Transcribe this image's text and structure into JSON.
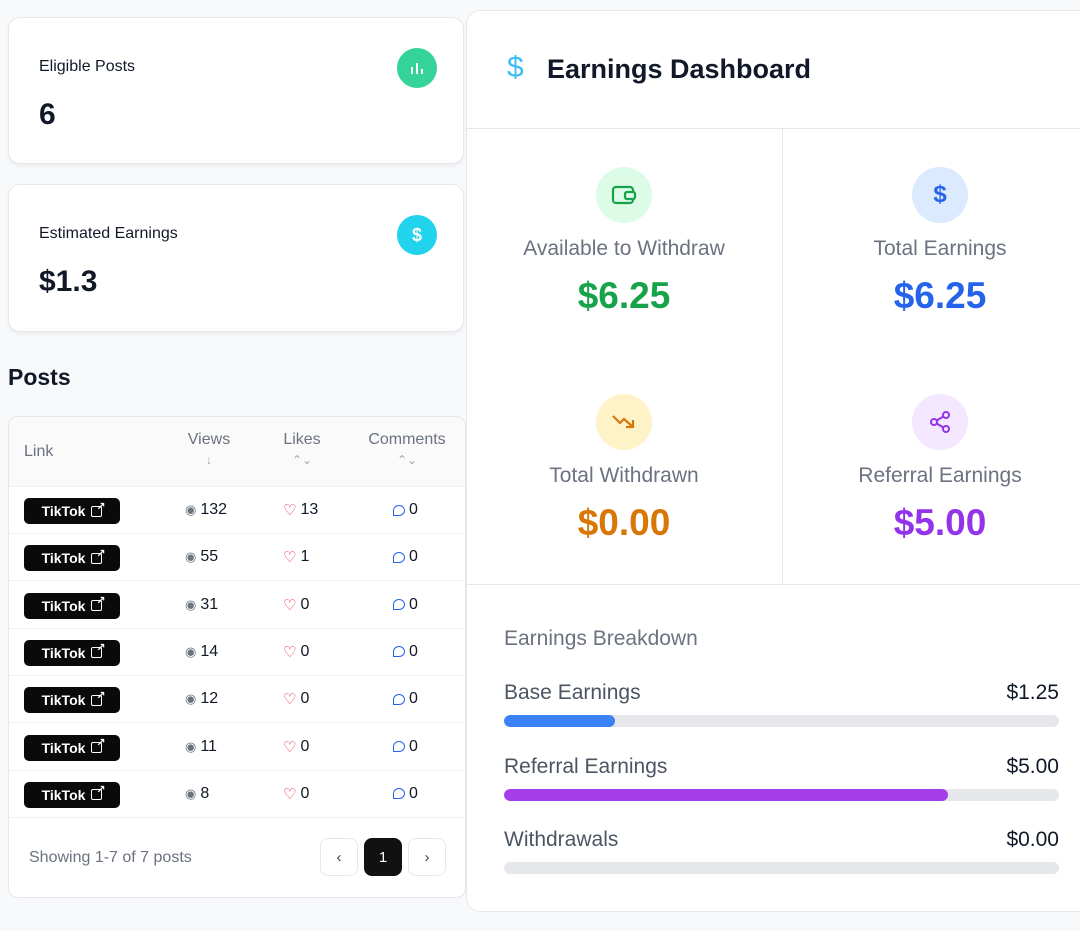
{
  "cards": {
    "eligible": {
      "label": "Eligible Posts",
      "value": "6",
      "icon": "bar-chart-icon",
      "color": "#34d399"
    },
    "estimated": {
      "label": "Estimated Earnings",
      "value": "$1.3",
      "icon": "dollar-icon",
      "color": "#22d3ee"
    }
  },
  "posts": {
    "title": "Posts",
    "columns": {
      "link": "Link",
      "views": "Views",
      "likes": "Likes",
      "comments": "Comments"
    },
    "sort": {
      "views": "↓",
      "likes": "⌃⌄",
      "comments": "⌃⌄"
    },
    "rows": [
      {
        "link": "TikTok",
        "views": "132",
        "likes": "13",
        "comments": "0"
      },
      {
        "link": "TikTok",
        "views": "55",
        "likes": "1",
        "comments": "0"
      },
      {
        "link": "TikTok",
        "views": "31",
        "likes": "0",
        "comments": "0"
      },
      {
        "link": "TikTok",
        "views": "14",
        "likes": "0",
        "comments": "0"
      },
      {
        "link": "TikTok",
        "views": "12",
        "likes": "0",
        "comments": "0"
      },
      {
        "link": "TikTok",
        "views": "11",
        "likes": "0",
        "comments": "0"
      },
      {
        "link": "TikTok",
        "views": "8",
        "likes": "0",
        "comments": "0"
      }
    ],
    "footer": "Showing 1-7 of 7 posts",
    "pagination": {
      "prev": "‹",
      "current": "1",
      "next": "›"
    }
  },
  "dashboard": {
    "title": "Earnings Dashboard",
    "tiles": {
      "available": {
        "label": "Available to Withdraw",
        "value": "$6.25",
        "color": "#16a34a"
      },
      "total": {
        "label": "Total Earnings",
        "value": "$6.25",
        "color": "#2563eb"
      },
      "withdrawn": {
        "label": "Total Withdrawn",
        "value": "$0.00",
        "color": "#d97706"
      },
      "referral": {
        "label": "Referral Earnings",
        "value": "$5.00",
        "color": "#9333ea"
      }
    },
    "breakdown": {
      "title": "Earnings Breakdown",
      "items": [
        {
          "label": "Base Earnings",
          "value": "$1.25",
          "fraction": 0.2,
          "color": "#3b82f6"
        },
        {
          "label": "Referral Earnings",
          "value": "$5.00",
          "fraction": 0.8,
          "color": "#a33ee8"
        },
        {
          "label": "Withdrawals",
          "value": "$0.00",
          "fraction": 0.0,
          "color": "#9ca3af"
        }
      ]
    }
  }
}
